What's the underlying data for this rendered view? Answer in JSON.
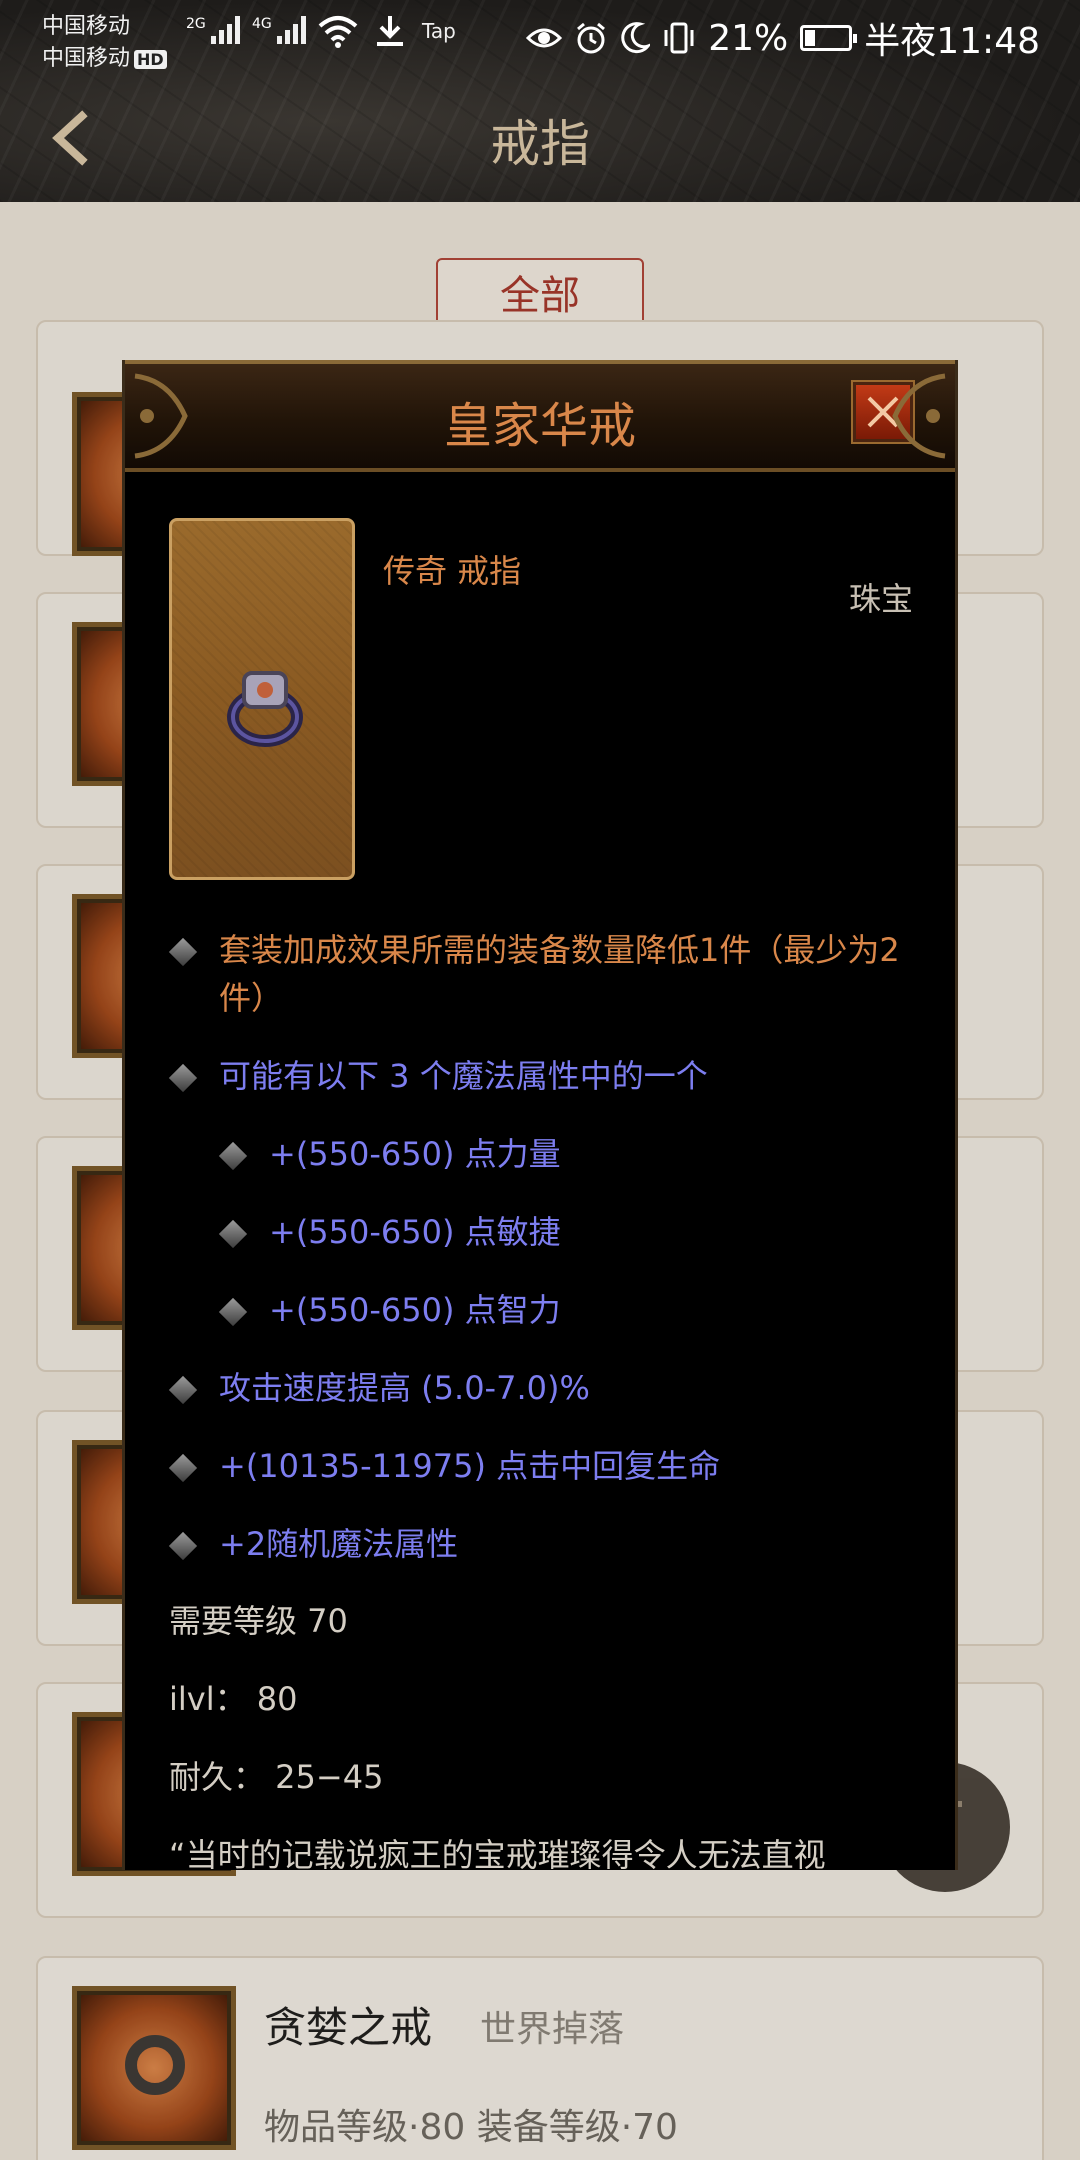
{
  "status_bar": {
    "carrier_1": "中国移动",
    "carrier_2": "中国移动",
    "hd_badge": "HD",
    "net_1": "2G",
    "net_2": "4G",
    "tap_label": "Tap",
    "battery": "21%",
    "time": "半夜11:48"
  },
  "header": {
    "title": "戒指"
  },
  "filter": {
    "label": "全部"
  },
  "list": {
    "bottom_item": {
      "name": "贪婪之戒",
      "source": "世界掉落",
      "meta": "物品等级·80   装备等级·70"
    }
  },
  "modal": {
    "title": "皇家华戒",
    "rarity_type": "传奇 戒指",
    "category": "珠宝",
    "properties": [
      {
        "text": "套装加成效果所需的装备数量降低1件（最少为2件）",
        "color": "orange",
        "level": 0
      },
      {
        "text": "可能有以下 3 个魔法属性中的一个",
        "color": "blue",
        "level": 0
      },
      {
        "text": "+(550-650) 点力量",
        "color": "blue",
        "level": 1
      },
      {
        "text": "+(550-650) 点敏捷",
        "color": "blue",
        "level": 1
      },
      {
        "text": "+(550-650) 点智力",
        "color": "blue",
        "level": 1
      },
      {
        "text": "攻击速度提高 (5.0-7.0)%",
        "color": "blue",
        "level": 0
      },
      {
        "text": "+(10135-11975) 点击中回复生命",
        "color": "blue",
        "level": 0
      },
      {
        "text": "+2随机魔法属性",
        "color": "blue",
        "level": 0
      }
    ],
    "required_level": "需要等级 70",
    "ilvl": "ilvl：  80",
    "durability": "耐久：  25−45",
    "flavor_partial": "“当时的记载说疯王的宝戒璀璨得令人无法直视"
  },
  "colors": {
    "legendary_orange": "#d9874a",
    "magic_blue": "#7d7ef0",
    "filter_red": "#a8372c"
  }
}
